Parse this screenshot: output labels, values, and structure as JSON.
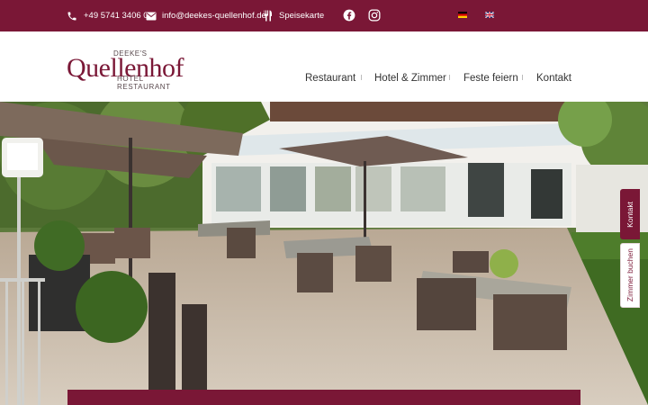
{
  "colors": {
    "brand": "#7a1736",
    "text": "#333333"
  },
  "topbar": {
    "phone": {
      "icon": "phone-icon",
      "label": "+49 5741 3406 0"
    },
    "email": {
      "icon": "envelope-icon",
      "label": "info@deekes-quellenhof.de"
    },
    "menu": {
      "icon": "cutlery-icon",
      "label": "Speisekarte"
    },
    "social": [
      "facebook-icon",
      "instagram-icon"
    ],
    "languages": [
      "german-flag-icon",
      "uk-flag-icon"
    ]
  },
  "logo": {
    "small_text": "DEEKE'S",
    "main_text": "Quellenhof",
    "sub_text": "HOTEL RESTAURANT"
  },
  "nav": {
    "items": [
      "Restaurant",
      "Hotel & Zimmer",
      "Feste feiern",
      "Kontakt"
    ]
  },
  "side_tabs": {
    "kontakt": "Kontakt",
    "zimmer": "Zimmer buchen"
  }
}
